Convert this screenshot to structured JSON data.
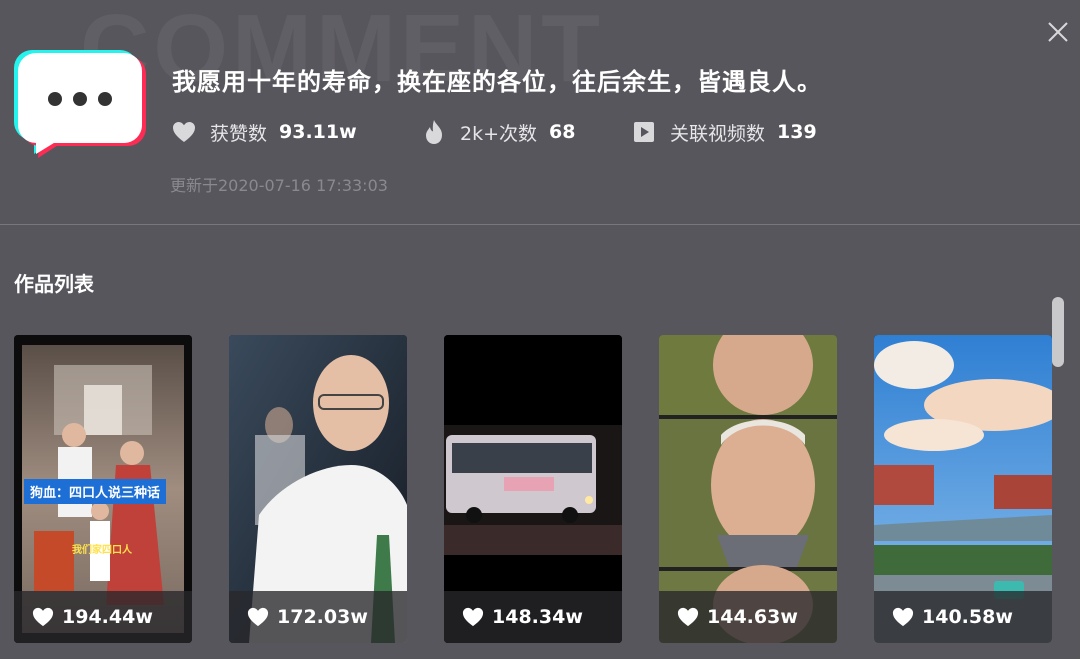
{
  "watermark": "COMMENT",
  "comment": {
    "title": "我愿用十年的寿命，换在座的各位，往后余生，皆遇良人。",
    "updated": "更新于2020-07-16 17:33:03"
  },
  "stats": [
    {
      "icon": "heart-icon",
      "label": "获赞数",
      "value": "93.11w"
    },
    {
      "icon": "flame-icon",
      "label": "2k+次数",
      "value": "68"
    },
    {
      "icon": "video-play-icon",
      "label": "关联视频数",
      "value": "139"
    }
  ],
  "section_title": "作品列表",
  "videos": [
    {
      "likes": "194.44w",
      "overlay_title": "狗血：四口人说三种话",
      "overlay_caption": "我们家四口人"
    },
    {
      "likes": "172.03w"
    },
    {
      "likes": "148.34w"
    },
    {
      "likes": "144.63w"
    },
    {
      "likes": "140.58w"
    }
  ],
  "colors": {
    "background": "#57565c",
    "accent_cyan": "#25f4ee",
    "accent_pink": "#fe2c55",
    "overlay_title_bg": "#1d6fd6"
  }
}
